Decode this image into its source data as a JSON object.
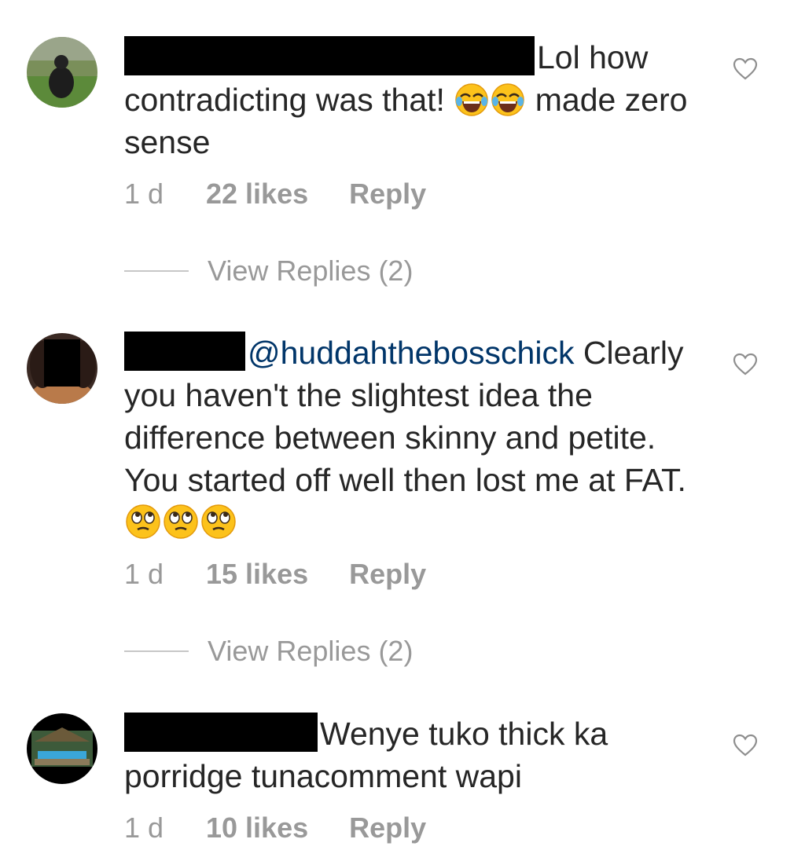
{
  "comments": [
    {
      "text_before_emoji": "Lol how contradicting was that! ",
      "emoji_count": 2,
      "emoji_name": "face-with-tears-of-joy",
      "text_after_emoji": " made zero sense",
      "time": "1 d",
      "likes": "22 likes",
      "reply": "Reply",
      "view_replies": "View Replies (2)"
    },
    {
      "mention": "@huddahthebosschick",
      "text": "Clearly you haven't the slightest idea the difference between skinny and petite. You started off well then lost me at FAT.",
      "emoji_count": 3,
      "emoji_name": "face-with-rolling-eyes",
      "time": "1 d",
      "likes": "15 likes",
      "reply": "Reply",
      "view_replies": "View Replies (2)"
    },
    {
      "text": "Wenye tuko thick ka porridge tunacomment wapi",
      "time": "1 d",
      "likes": "10 likes",
      "reply": "Reply"
    }
  ],
  "colors": {
    "text": "#262626",
    "muted": "#999999",
    "mention": "#003569",
    "redaction": "#000000"
  }
}
